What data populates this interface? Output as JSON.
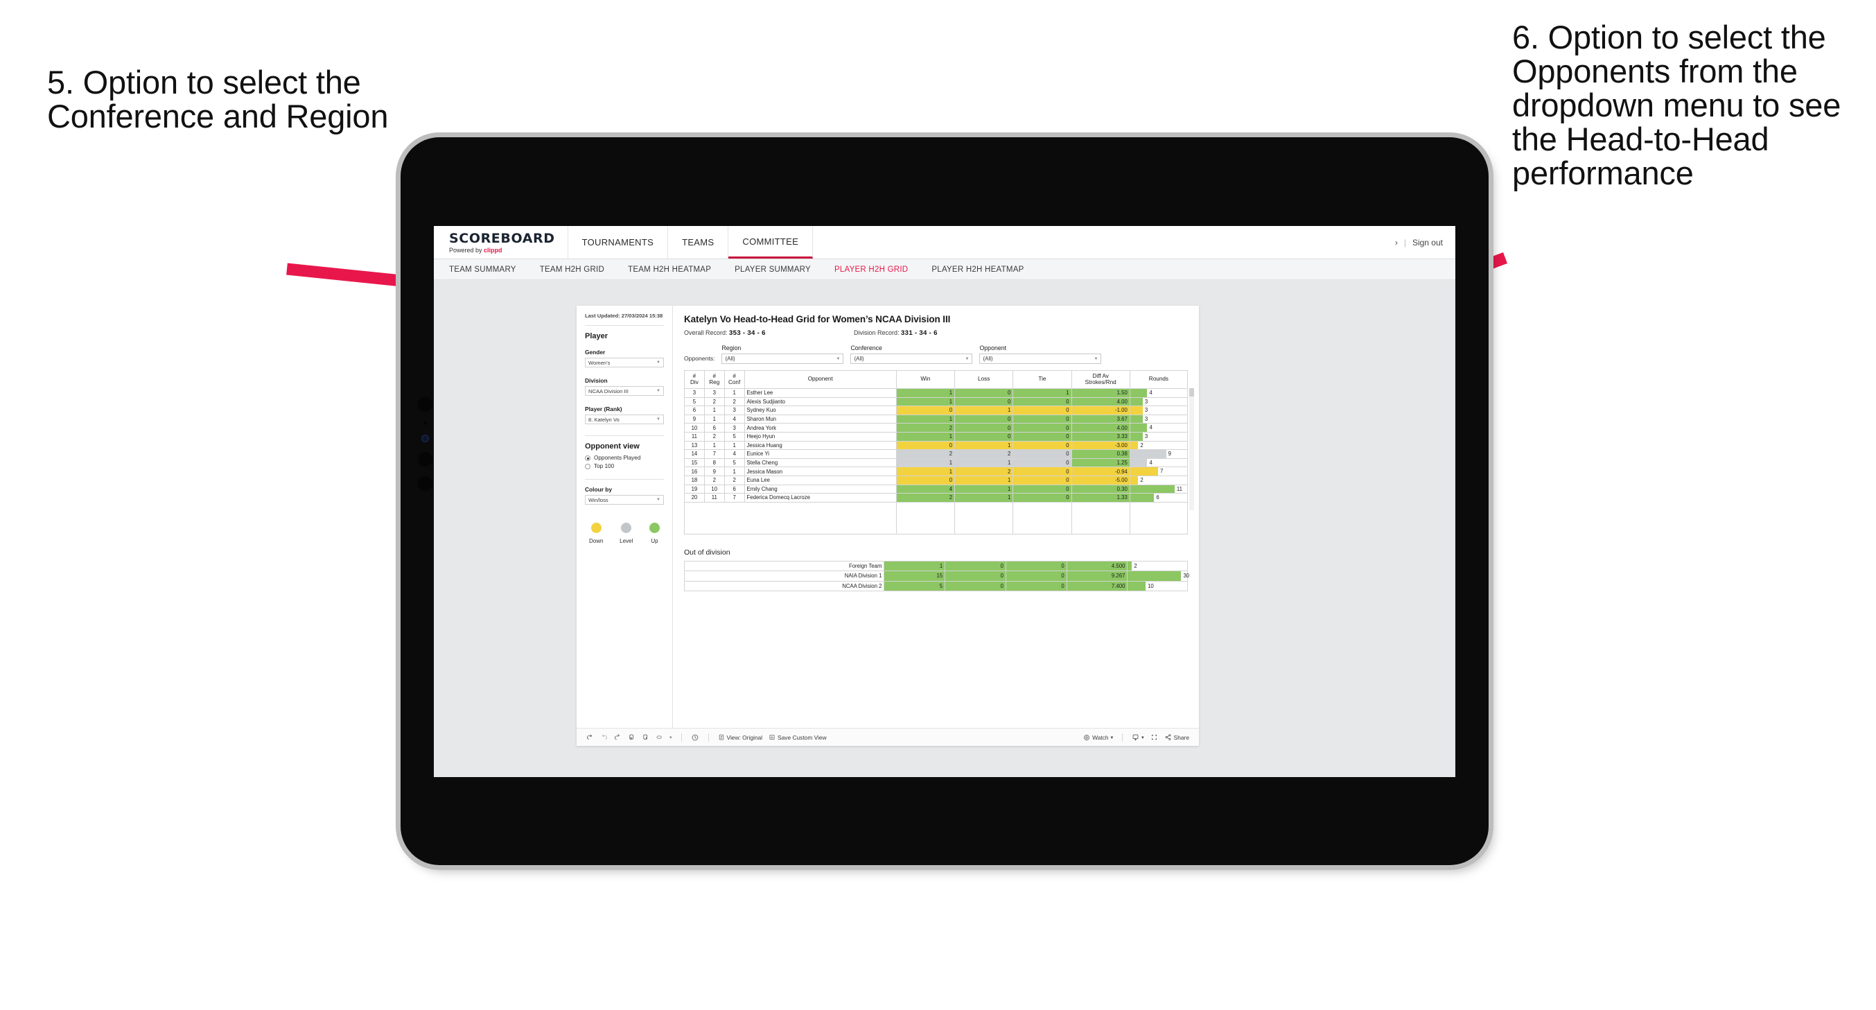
{
  "annotations": {
    "left": "5. Option to select the Conference and Region",
    "right": "6. Option to select the Opponents from the dropdown menu to see the Head-to-Head performance",
    "arrow_color": "#e8174b"
  },
  "topnav": {
    "logo_main": "SCOREBOARD",
    "logo_sub_prefix": "Powered by ",
    "logo_brand": "clippd",
    "items": [
      "TOURNAMENTS",
      "TEAMS",
      "COMMITTEE"
    ],
    "active": "COMMITTEE",
    "chevron": "›",
    "separator": "|",
    "sign_out": "Sign out"
  },
  "subnav": {
    "items": [
      "TEAM SUMMARY",
      "TEAM H2H GRID",
      "TEAM H2H HEATMAP",
      "PLAYER SUMMARY",
      "PLAYER H2H GRID",
      "PLAYER H2H HEATMAP"
    ],
    "active": "PLAYER H2H GRID"
  },
  "sidebar": {
    "last_updated": "Last Updated: 27/03/2024 15:38",
    "player_heading": "Player",
    "gender_label": "Gender",
    "gender_value": "Women’s",
    "division_label": "Division",
    "division_value": "NCAA Division III",
    "player_rank_label": "Player (Rank)",
    "player_rank_value": "8. Katelyn Vo",
    "opponent_view_heading": "Opponent view",
    "opponent_view_options": [
      "Opponents Played",
      "Top 100"
    ],
    "opponent_view_selected": "Opponents Played",
    "colour_by_label": "Colour by",
    "colour_by_value": "Win/loss",
    "legend": [
      {
        "label": "Down",
        "color": "#f2d23f"
      },
      {
        "label": "Level",
        "color": "#c3c6c8"
      },
      {
        "label": "Up",
        "color": "#8cc763"
      }
    ]
  },
  "viz": {
    "title": "Katelyn Vo Head-to-Head Grid for Women’s NCAA Division III",
    "overall_record_label": "Overall Record:",
    "overall_record_value": "353 - 34 - 6",
    "division_record_label": "Division Record:",
    "division_record_value": "331 - 34 - 6",
    "opponents_label": "Opponents:",
    "filters": [
      {
        "label": "Region",
        "value": "(All)"
      },
      {
        "label": "Conference",
        "value": "(All)"
      },
      {
        "label": "Opponent",
        "value": "(All)"
      }
    ],
    "columns": [
      "# Div",
      "# Reg",
      "# Conf",
      "Opponent",
      "Win",
      "Loss",
      "Tie",
      "Diff Av Strokes/Rnd",
      "Rounds"
    ],
    "column_lines": [
      [
        "#",
        "Div"
      ],
      [
        "#",
        "Reg"
      ],
      [
        "#",
        "Conf"
      ],
      [
        "Opponent",
        ""
      ],
      [
        "Win",
        ""
      ],
      [
        "Loss",
        ""
      ],
      [
        "Tie",
        ""
      ],
      [
        "Diff Av",
        "Strokes/Rnd"
      ],
      [
        "Rounds",
        ""
      ]
    ],
    "rows": [
      {
        "div": "3",
        "reg": "3",
        "conf": "1",
        "opponent": "Esther Lee",
        "win": "1",
        "loss": "0",
        "tie": "1",
        "diff": "1.50",
        "rounds": "4",
        "color": "green",
        "diff_color": "green",
        "bar_pct": 30
      },
      {
        "div": "5",
        "reg": "2",
        "conf": "2",
        "opponent": "Alexis Sudjianto",
        "win": "1",
        "loss": "0",
        "tie": "0",
        "diff": "4.00",
        "rounds": "3",
        "color": "green",
        "diff_color": "green",
        "bar_pct": 22
      },
      {
        "div": "6",
        "reg": "1",
        "conf": "3",
        "opponent": "Sydney Kuo",
        "win": "0",
        "loss": "1",
        "tie": "0",
        "diff": "-1.00",
        "rounds": "3",
        "color": "yellow",
        "diff_color": "yellow",
        "bar_pct": 22
      },
      {
        "div": "9",
        "reg": "1",
        "conf": "4",
        "opponent": "Sharon Mun",
        "win": "1",
        "loss": "0",
        "tie": "0",
        "diff": "3.67",
        "rounds": "3",
        "color": "green",
        "diff_color": "green",
        "bar_pct": 22
      },
      {
        "div": "10",
        "reg": "6",
        "conf": "3",
        "opponent": "Andrea York",
        "win": "2",
        "loss": "0",
        "tie": "0",
        "diff": "4.00",
        "rounds": "4",
        "color": "green",
        "diff_color": "green",
        "bar_pct": 30
      },
      {
        "div": "11",
        "reg": "2",
        "conf": "5",
        "opponent": "Heejo Hyun",
        "win": "1",
        "loss": "0",
        "tie": "0",
        "diff": "3.33",
        "rounds": "3",
        "color": "green",
        "diff_color": "green",
        "bar_pct": 22
      },
      {
        "div": "13",
        "reg": "1",
        "conf": "1",
        "opponent": "Jessica Huang",
        "win": "0",
        "loss": "1",
        "tie": "0",
        "diff": "-3.00",
        "rounds": "2",
        "color": "yellow",
        "diff_color": "yellow",
        "bar_pct": 14
      },
      {
        "div": "14",
        "reg": "7",
        "conf": "4",
        "opponent": "Eunice Yi",
        "win": "2",
        "loss": "2",
        "tie": "0",
        "diff": "0.38",
        "rounds": "9",
        "color": "grey",
        "diff_color": "green",
        "bar_pct": 63
      },
      {
        "div": "15",
        "reg": "8",
        "conf": "5",
        "opponent": "Stella Cheng",
        "win": "1",
        "loss": "1",
        "tie": "0",
        "diff": "1.25",
        "rounds": "4",
        "color": "grey",
        "diff_color": "green",
        "bar_pct": 30
      },
      {
        "div": "16",
        "reg": "9",
        "conf": "1",
        "opponent": "Jessica Mason",
        "win": "1",
        "loss": "2",
        "tie": "0",
        "diff": "-0.94",
        "rounds": "7",
        "color": "yellow",
        "diff_color": "yellow",
        "bar_pct": 49
      },
      {
        "div": "18",
        "reg": "2",
        "conf": "2",
        "opponent": "Euna Lee",
        "win": "0",
        "loss": "1",
        "tie": "0",
        "diff": "-5.00",
        "rounds": "2",
        "color": "yellow",
        "diff_color": "yellow",
        "bar_pct": 14
      },
      {
        "div": "19",
        "reg": "10",
        "conf": "6",
        "opponent": "Emily Chang",
        "win": "4",
        "loss": "1",
        "tie": "0",
        "diff": "0.30",
        "rounds": "11",
        "color": "green",
        "diff_color": "green",
        "bar_pct": 78
      },
      {
        "div": "20",
        "reg": "11",
        "conf": "7",
        "opponent": "Federica Domecq Lacroze",
        "win": "2",
        "loss": "1",
        "tie": "0",
        "diff": "1.33",
        "rounds": "6",
        "color": "green",
        "diff_color": "green",
        "bar_pct": 42
      }
    ],
    "out_of_division_title": "Out of division",
    "out_of_division_rows": [
      {
        "name": "Foreign Team",
        "win": "1",
        "loss": "0",
        "tie": "0",
        "diff": "4.500",
        "rounds": "2",
        "color": "green",
        "bar_pct": 7
      },
      {
        "name": "NAIA Division 1",
        "win": "15",
        "loss": "0",
        "tie": "0",
        "diff": "9.267",
        "rounds": "30",
        "color": "green",
        "bar_pct": 90
      },
      {
        "name": "NCAA Division 2",
        "win": "5",
        "loss": "0",
        "tie": "0",
        "diff": "7.400",
        "rounds": "10",
        "color": "green",
        "bar_pct": 30
      }
    ],
    "colors": {
      "green": "#8cc763",
      "yellow": "#f2d23f",
      "grey": "#cfd2d4"
    }
  },
  "toolbar": {
    "undo": "undo-icon",
    "redo": "redo-icon",
    "revert": "revert-icon",
    "refresh": "refresh-icon",
    "pause": "pause-icon",
    "alerts_caret": "▾",
    "view_label": "View: Original",
    "save_custom_view_label": "Save Custom View",
    "watch_label": "Watch",
    "watch_caret": "▾",
    "download_caret": "▾",
    "share_label": "Share"
  }
}
